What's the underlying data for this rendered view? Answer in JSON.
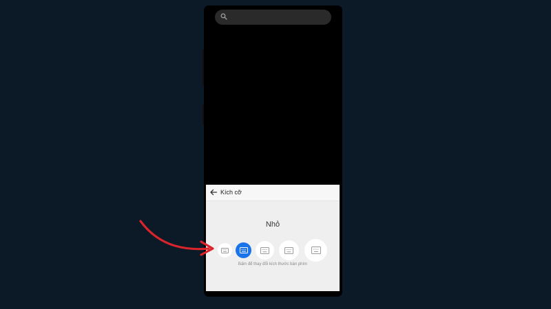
{
  "colors": {
    "background": "#0c1a28",
    "panel": "#efefef",
    "accent": "#1a73e8",
    "arrow": "#d9242c"
  },
  "search": {
    "icon": "search-icon"
  },
  "panel": {
    "back_icon": "arrow-left-icon",
    "title": "Kích cỡ",
    "size_label": "Nhỏ",
    "hint": "Bấm để thay đổi kích thước bàn phím",
    "options": [
      {
        "icon": "keyboard-icon",
        "selected": false
      },
      {
        "icon": "keyboard-icon",
        "selected": true
      },
      {
        "icon": "keyboard-icon",
        "selected": false
      },
      {
        "icon": "keyboard-icon",
        "selected": false
      },
      {
        "icon": "keyboard-icon",
        "selected": false
      }
    ]
  }
}
